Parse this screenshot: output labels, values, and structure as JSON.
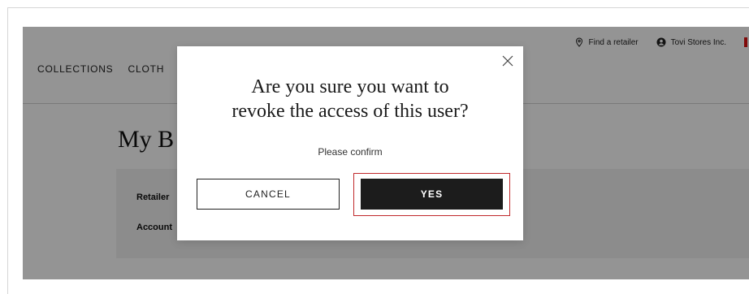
{
  "utility": {
    "find_retailer": "Find a retailer",
    "account_name": "Tovi Stores Inc."
  },
  "nav": {
    "items": [
      "COLLECTIONS",
      "CLOTH"
    ]
  },
  "page": {
    "title": "My B",
    "info_labels": [
      "Retailer",
      "Account"
    ]
  },
  "modal": {
    "title": "Are you sure you want to\nrevoke the access of this user?",
    "subtitle": "Please confirm",
    "cancel_label": "CANCEL",
    "yes_label": "YES"
  },
  "colors": {
    "overlay": "rgba(0,0,0,0.42)",
    "primary_button": "#1c1c1c",
    "highlight_border": "#c0292b"
  },
  "icons": [
    "location-pin-icon",
    "user-circle-icon",
    "close-icon"
  ]
}
